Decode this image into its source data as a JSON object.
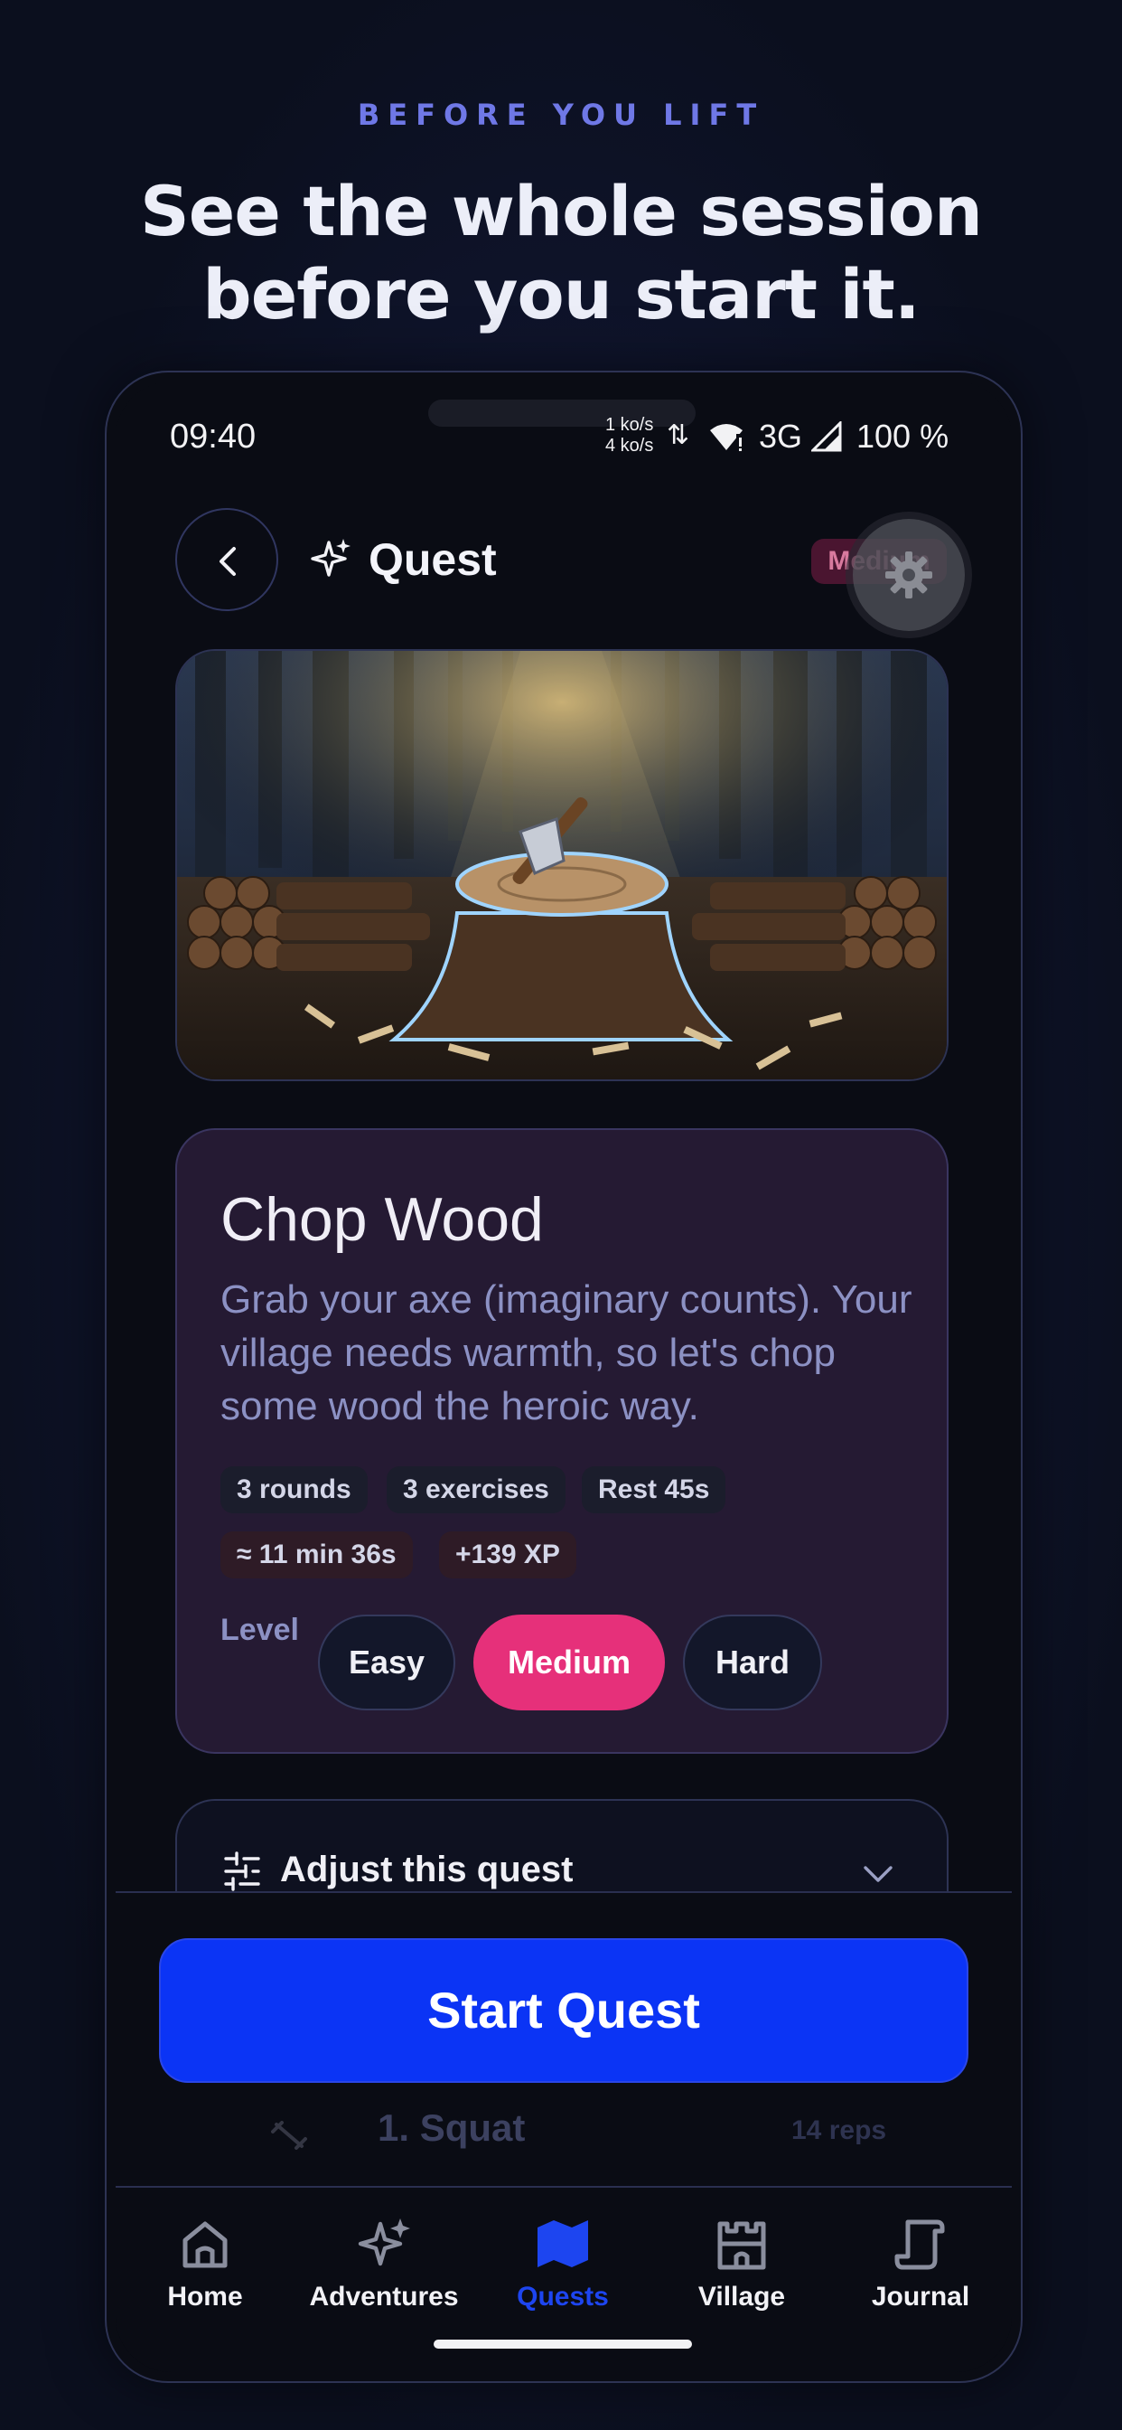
{
  "promo": {
    "eyebrow": "BEFORE YOU LIFT",
    "headline_line1": "See the whole session",
    "headline_line2": "before you start it."
  },
  "status_bar": {
    "time": "09:40",
    "speed_up": "1 ko/s",
    "speed_down": "4 ko/s",
    "network": "3G",
    "battery": "100 %"
  },
  "header": {
    "back_icon": "chevron-left-icon",
    "title_icon": "sparkle-icon",
    "title": "Quest",
    "difficulty_badge": "Medium",
    "settings_icon": "gear-icon"
  },
  "quest": {
    "name": "Chop Wood",
    "description": "Grab your axe (imaginary counts). Your village needs warmth, so let's chop some wood the heroic way.",
    "chips": [
      "3 rounds",
      "3 exercises",
      "Rest 45s"
    ],
    "stats": [
      "≈ 11 min 36s",
      "+139 XP"
    ],
    "level_label": "Level",
    "levels": [
      "Easy",
      "Medium",
      "Hard"
    ],
    "selected_level": "Medium"
  },
  "adjust": {
    "label": "Adjust this quest",
    "icon": "sliders-icon"
  },
  "start_button": "Start Quest",
  "exercise_peek": {
    "name": "1. Squat",
    "reps": "14 reps"
  },
  "tabs": [
    {
      "label": "Home",
      "icon": "home-icon"
    },
    {
      "label": "Adventures",
      "icon": "sparkle-icon"
    },
    {
      "label": "Quests",
      "icon": "map-icon"
    },
    {
      "label": "Village",
      "icon": "castle-icon"
    },
    {
      "label": "Journal",
      "icon": "scroll-icon"
    }
  ],
  "active_tab": "Quests",
  "colors": {
    "accent_blue": "#0b34f5",
    "accent_pink": "#e6307a",
    "eyebrow": "#6f78e6"
  }
}
